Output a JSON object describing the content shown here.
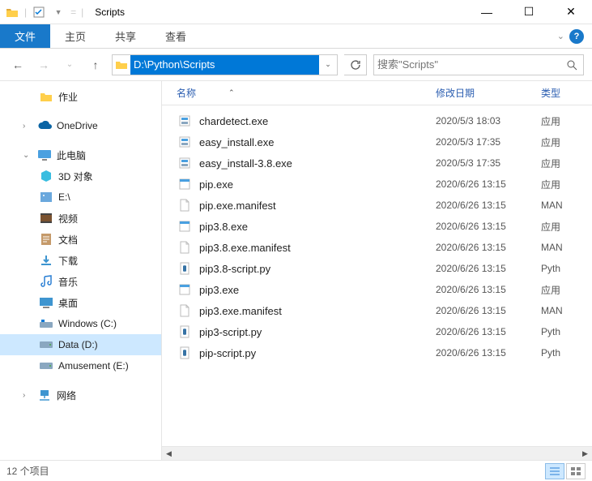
{
  "window": {
    "title": "Scripts",
    "minimize": "—",
    "maximize": "☐",
    "close": "✕"
  },
  "ribbon": {
    "tabs": [
      "文件",
      "主页",
      "共享",
      "查看"
    ],
    "active_index": 0
  },
  "nav": {
    "address": "D:\\Python\\Scripts",
    "search_placeholder": "搜索\"Scripts\""
  },
  "tree": [
    {
      "label": "作业",
      "level": 2,
      "icon": "folder",
      "color": "#ffcf4b"
    },
    {
      "label": "",
      "level": 0,
      "icon": "spacer"
    },
    {
      "label": "OneDrive",
      "level": 1,
      "icon": "onedrive",
      "color": "#0a64a4"
    },
    {
      "label": "",
      "level": 0,
      "icon": "spacer"
    },
    {
      "label": "此电脑",
      "level": 1,
      "icon": "pc",
      "color": "#4aa0e0",
      "caret": true
    },
    {
      "label": "3D 对象",
      "level": 2,
      "icon": "3d",
      "color": "#39bde0"
    },
    {
      "label": "E:\\",
      "level": 2,
      "icon": "drive-img",
      "color": "#6aa8dd"
    },
    {
      "label": "视频",
      "level": 2,
      "icon": "video",
      "color": "#7a5230"
    },
    {
      "label": "文档",
      "level": 2,
      "icon": "docs",
      "color": "#c59a6a"
    },
    {
      "label": "下载",
      "level": 2,
      "icon": "download",
      "color": "#3e95d0"
    },
    {
      "label": "音乐",
      "level": 2,
      "icon": "music",
      "color": "#2a7fd4"
    },
    {
      "label": "桌面",
      "level": 2,
      "icon": "desktop",
      "color": "#3e95d0"
    },
    {
      "label": "Windows (C:)",
      "level": 2,
      "icon": "drive-win",
      "color": "#8aa7c0"
    },
    {
      "label": "Data (D:)",
      "level": 2,
      "icon": "drive",
      "color": "#8aa7c0",
      "selected": true
    },
    {
      "label": "Amusement (E:)",
      "level": 2,
      "icon": "drive",
      "color": "#8aa7c0"
    },
    {
      "label": "",
      "level": 0,
      "icon": "spacer"
    },
    {
      "label": "网络",
      "level": 1,
      "icon": "network",
      "color": "#3e95d0"
    }
  ],
  "columns": {
    "name": "名称",
    "date": "修改日期",
    "type": "类型"
  },
  "files": [
    {
      "name": "chardetect.exe",
      "date": "2020/5/3 18:03",
      "type": "应用",
      "icon": "exe"
    },
    {
      "name": "easy_install.exe",
      "date": "2020/5/3 17:35",
      "type": "应用",
      "icon": "exe"
    },
    {
      "name": "easy_install-3.8.exe",
      "date": "2020/5/3 17:35",
      "type": "应用",
      "icon": "exe"
    },
    {
      "name": "pip.exe",
      "date": "2020/6/26 13:15",
      "type": "应用",
      "icon": "exe-blank"
    },
    {
      "name": "pip.exe.manifest",
      "date": "2020/6/26 13:15",
      "type": "MAN",
      "icon": "file"
    },
    {
      "name": "pip3.8.exe",
      "date": "2020/6/26 13:15",
      "type": "应用",
      "icon": "exe-blank"
    },
    {
      "name": "pip3.8.exe.manifest",
      "date": "2020/6/26 13:15",
      "type": "MAN",
      "icon": "file"
    },
    {
      "name": "pip3.8-script.py",
      "date": "2020/6/26 13:15",
      "type": "Pyth",
      "icon": "py"
    },
    {
      "name": "pip3.exe",
      "date": "2020/6/26 13:15",
      "type": "应用",
      "icon": "exe-blank"
    },
    {
      "name": "pip3.exe.manifest",
      "date": "2020/6/26 13:15",
      "type": "MAN",
      "icon": "file"
    },
    {
      "name": "pip3-script.py",
      "date": "2020/6/26 13:15",
      "type": "Pyth",
      "icon": "py"
    },
    {
      "name": "pip-script.py",
      "date": "2020/6/26 13:15",
      "type": "Pyth",
      "icon": "py"
    }
  ],
  "status": {
    "count": "12 个项目"
  }
}
